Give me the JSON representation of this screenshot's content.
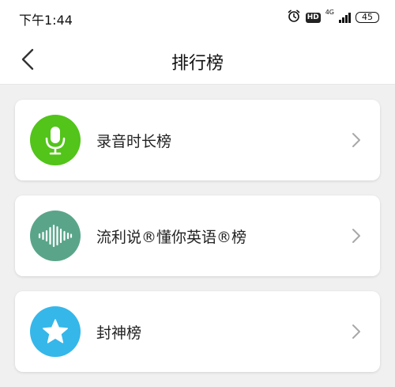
{
  "status_bar": {
    "time": "下午1:44",
    "hd_badge": "HD",
    "network": "4G",
    "battery": "45"
  },
  "header": {
    "title": "排行榜",
    "back_icon": "chevron-left-icon"
  },
  "rankings": [
    {
      "label": "录音时长榜",
      "icon": "microphone-icon",
      "color": "#52c41a"
    },
    {
      "label": "流利说®懂你英语®榜",
      "icon": "sound-wave-icon",
      "color": "#5aa58a"
    },
    {
      "label": "封神榜",
      "icon": "star-icon",
      "color": "#35b7ea"
    }
  ]
}
